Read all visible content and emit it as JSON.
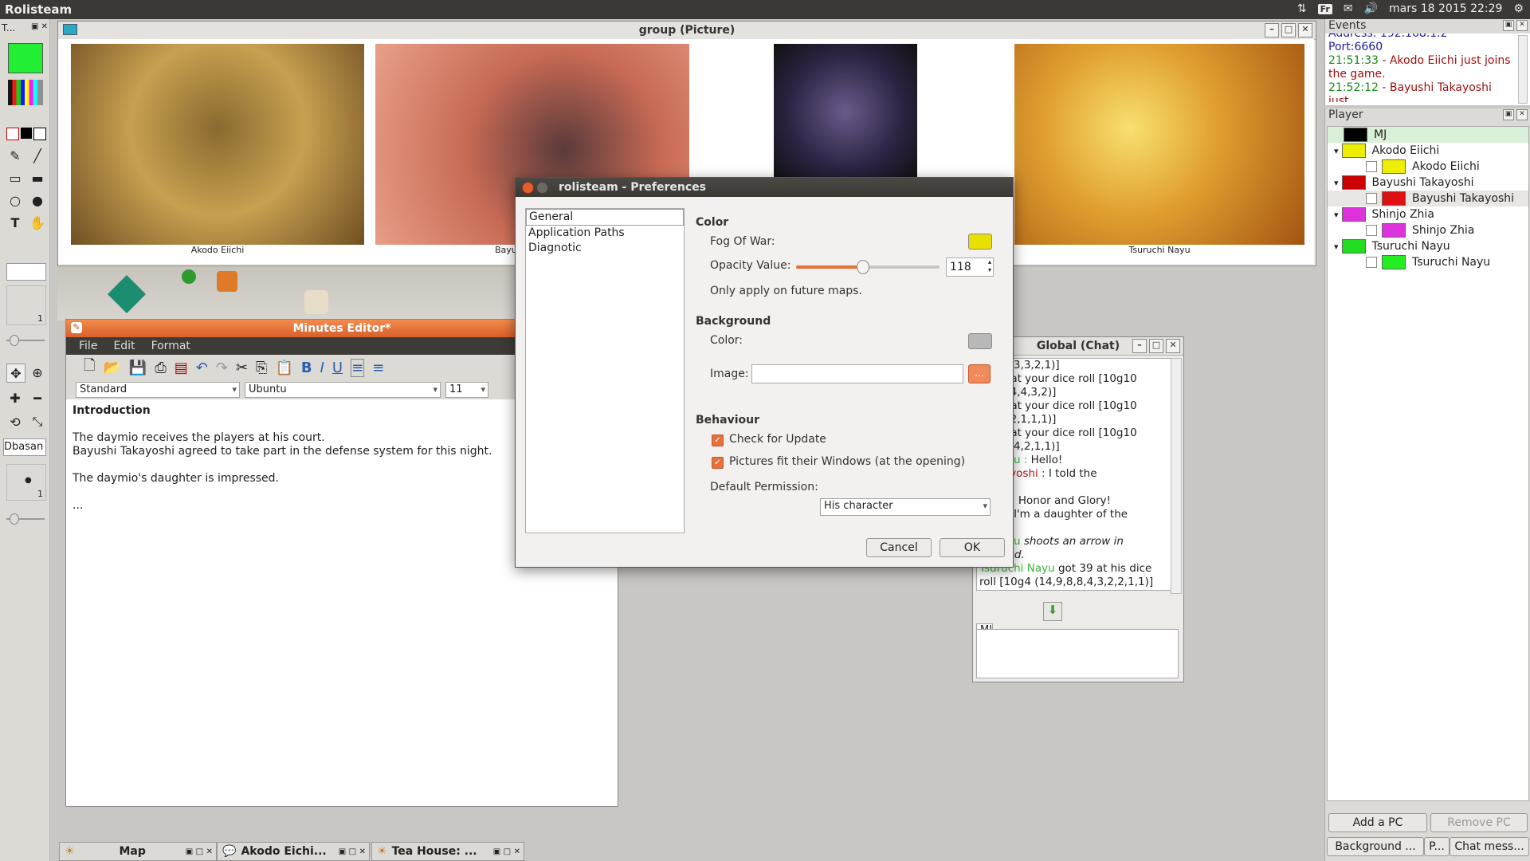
{
  "topbar": {
    "app_name": "Rolisteam",
    "keyboard": "Fr",
    "datetime": "mars 18 2015 22:29"
  },
  "toolbar": {
    "header": "T...",
    "counter_top": "1",
    "npc_name": "Dbasan",
    "counter_bottom": "1",
    "current_color": "#22ee33"
  },
  "picture_window": {
    "title": "group (Picture)",
    "captions": [
      "Akodo Eiichi",
      "Bayu",
      "Tsuruchi Nayu"
    ]
  },
  "events": {
    "title": "Events",
    "lines": [
      {
        "text": "Address: 192.168.1.2",
        "color": "#1a1aa0"
      },
      {
        "text": "Port:6660",
        "color": "#1a1aa0"
      },
      {
        "time": "21:51:33",
        "msg": " - Akodo Eiichi just joins the game.",
        "color": "#a01010"
      },
      {
        "time": "21:52:12",
        "msg": " - Bayushi Takayoshi just",
        "color": "#a01010"
      }
    ]
  },
  "player_panel": {
    "title": "Player",
    "rows": [
      {
        "name": "MJ",
        "color": "#000000",
        "level": 0,
        "selected": true
      },
      {
        "name": "Akodo Eiichi",
        "color": "#eeee00",
        "level": 0
      },
      {
        "name": "Akodo Eiichi",
        "color": "#eeee00",
        "level": 1
      },
      {
        "name": "Bayushi Takayoshi",
        "color": "#cc0000",
        "level": 0
      },
      {
        "name": "Bayushi Takayoshi",
        "color": "#dd1111",
        "level": 1
      },
      {
        "name": "Shinjo Zhia",
        "color": "#dd33dd",
        "level": 0
      },
      {
        "name": "Shinjo Zhia",
        "color": "#dd33dd",
        "level": 1
      },
      {
        "name": "Tsuruchi Nayu",
        "color": "#22dd22",
        "level": 0
      },
      {
        "name": "Tsuruchi Nayu",
        "color": "#22ee22",
        "level": 1
      }
    ],
    "add_pc": "Add a PC",
    "remove_pc": "Remove PC",
    "bottom_tabs": [
      "Background ...",
      "P...",
      "Chat mess..."
    ]
  },
  "minutes": {
    "title": "Minutes Editor*",
    "menu": [
      "File",
      "Edit",
      "Format"
    ],
    "style": "Standard",
    "font": "Ubuntu",
    "size": "11",
    "heading": "Introduction",
    "lines": [
      "The daymio receives the players at his court.",
      "Bayushi Takayoshi agreed to take part in the defense system for this night.",
      "The daymio's daughter is impressed.",
      "..."
    ]
  },
  "chat": {
    "title": "Global (Chat)",
    "lines": [
      {
        "parts": [
          {
            "t": ",7,6,3,3,3,2,1)]"
          }
        ]
      },
      {
        "parts": [
          {
            "t": "ot 55 at your dice roll [10g10"
          }
        ]
      },
      {
        "parts": [
          {
            "t": "3,4,4,4,4,3,2)]"
          }
        ]
      },
      {
        "parts": [
          {
            "t": "ot 34 at your dice roll [10g10"
          }
        ]
      },
      {
        "parts": [
          {
            "t": "4,3,2,2,1,1,1)]"
          }
        ]
      },
      {
        "parts": [
          {
            "t": "ot 67 at your dice roll [10g10"
          }
        ]
      },
      {
        "parts": [
          {
            "t": ",6,6,4,4,2,1,1)]"
          }
        ]
      },
      {
        "parts": [
          {
            "t": "hi Nayu : ",
            "c": "#3cb43c"
          },
          {
            "t": "Hello!"
          }
        ]
      },
      {
        "parts": [
          {
            "t": "i Takayoshi : ",
            "c": "#b01010"
          },
          {
            "t": "I told the"
          }
        ]
      },
      {
        "parts": [
          {
            "t": ""
          }
        ]
      },
      {
        "parts": [
          {
            "t": "Eiichi : ",
            "c": "#c8b400"
          },
          {
            "t": "Honor and Glory!"
          }
        ]
      },
      {
        "parts": [
          {
            "t": "Zhia : ",
            "c": "#c030c0"
          },
          {
            "t": "I'm a daughter of the"
          }
        ]
      },
      {
        "parts": [
          {
            "t": ""
          }
        ]
      },
      {
        "parts": [
          {
            "t": "hi Nayu ",
            "c": "#3cb43c"
          },
          {
            "t": "shoots an arrow in",
            "i": true
          }
        ]
      },
      {
        "parts": [
          {
            "t": "i's head.",
            "i": true
          }
        ]
      },
      {
        "parts": [
          {
            "t": "Tsuruchi Nayu ",
            "c": "#3cb43c"
          },
          {
            "t": "got 39 at his dice"
          }
        ]
      },
      {
        "parts": [
          {
            "t": "roll [10g4 (14,9,8,8,4,3,2,2,1,1)]"
          }
        ]
      }
    ],
    "sender": "MJ"
  },
  "prefs": {
    "title": "rolisteam - Preferences",
    "nav": [
      "General",
      "Application Paths",
      "Diagnotic"
    ],
    "color_section": "Color",
    "fog_label": "Fog Of War:",
    "fog_color": "#e8e000",
    "opacity_label": "Opacity Value:",
    "opacity_value": "118",
    "opacity_fraction": 0.46,
    "future_maps": "Only apply on future maps.",
    "background_section": "Background",
    "bg_color_label": "Color:",
    "bg_color": "#b8b8b8",
    "image_label": "Image:",
    "image_value": "",
    "browse": "...",
    "behaviour_section": "Behaviour",
    "check_update": "Check for Update",
    "pictures_fit": "Pictures fit their Windows (at the opening)",
    "permission_label": "Default Permission:",
    "permission_value": "His character",
    "cancel": "Cancel",
    "ok": "OK"
  },
  "bottom_tabs": [
    {
      "label": "Map"
    },
    {
      "label": "Akodo Eichi..."
    },
    {
      "label": "Tea House: ..."
    }
  ]
}
